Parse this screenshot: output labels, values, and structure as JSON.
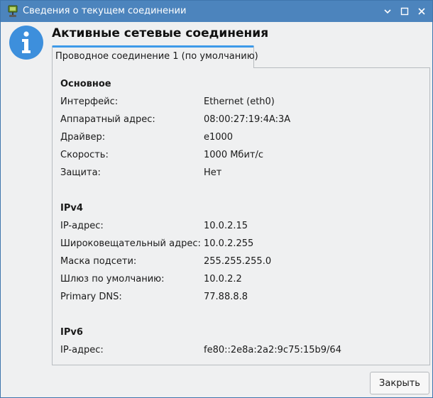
{
  "window": {
    "title": "Сведения о текущем соединении",
    "app_icon": "network-connection-icon",
    "controls": [
      "minimize-icon",
      "maximize-icon",
      "close-icon"
    ]
  },
  "dialog": {
    "icon": "info-icon",
    "heading": "Активные сетевые соединения",
    "tabs": [
      {
        "label": "Проводное соединение 1 (по умолчанию)"
      }
    ]
  },
  "sections": {
    "basic": {
      "title": "Основное",
      "rows": [
        {
          "label": "Интерфейс:",
          "value": "Ethernet (eth0)"
        },
        {
          "label": "Аппаратный адрес:",
          "value": "08:00:27:19:4A:3A"
        },
        {
          "label": "Драйвер:",
          "value": "e1000"
        },
        {
          "label": "Скорость:",
          "value": "1000 Мбит/с"
        },
        {
          "label": "Защита:",
          "value": "Нет"
        }
      ]
    },
    "ipv4": {
      "title": "IPv4",
      "rows": [
        {
          "label": "IP-адрес:",
          "value": "10.0.2.15"
        },
        {
          "label": "Широковещательный адрес:",
          "value": "10.0.2.255"
        },
        {
          "label": "Маска подсети:",
          "value": "255.255.255.0"
        },
        {
          "label": "Шлюз по умолчанию:",
          "value": "10.0.2.2"
        },
        {
          "label": "Primary DNS:",
          "value": "77.88.8.8"
        }
      ]
    },
    "ipv6": {
      "title": "IPv6",
      "rows": [
        {
          "label": "IP-адрес:",
          "value": "fe80::2e8a:2a2:9c75:15b9/64"
        }
      ]
    }
  },
  "buttons": {
    "close_label": "Закрыть"
  },
  "colors": {
    "titlebar": "#4c84bd",
    "tab_accent": "#3d9ae9",
    "info_icon": "#3d8fdc",
    "background": "#eff0f1"
  }
}
